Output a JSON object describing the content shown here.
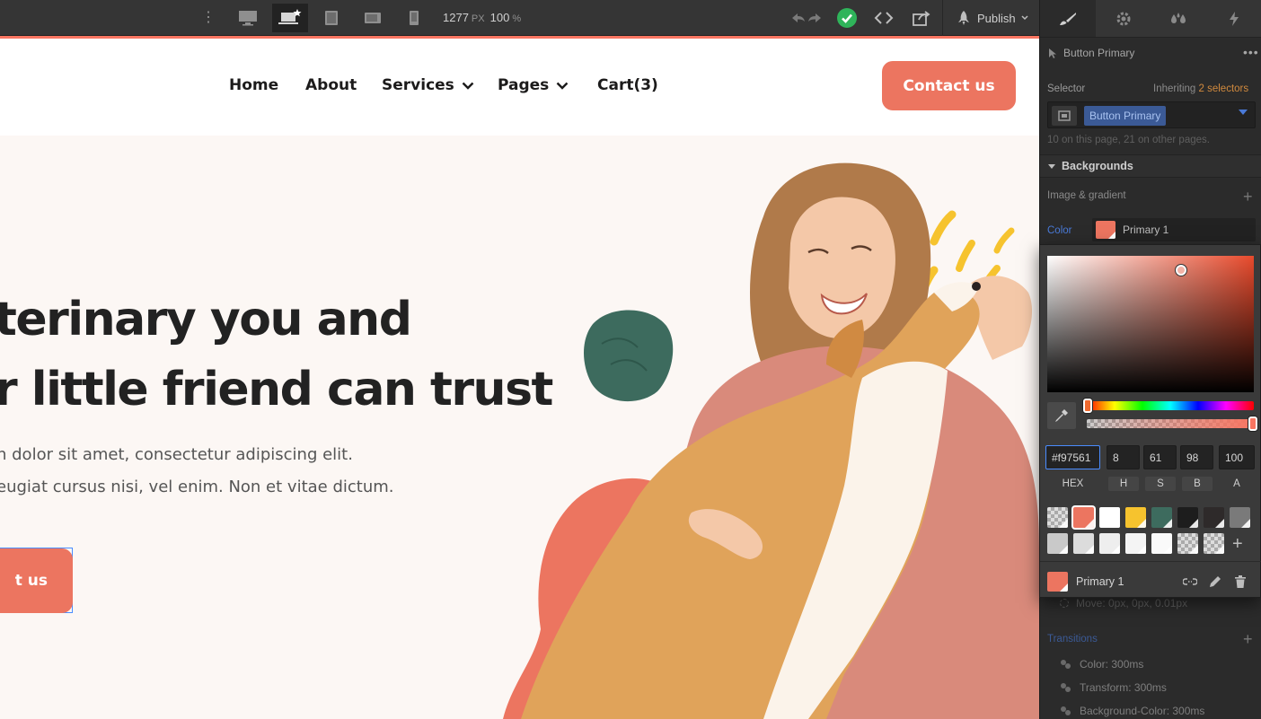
{
  "toolbar": {
    "width_value": "1277",
    "width_unit": "PX",
    "zoom_value": "100",
    "zoom_unit": "%",
    "publish_label": "Publish",
    "breakpoints": [
      "desktop",
      "desktop-base",
      "tablet",
      "mobile-landscape",
      "mobile-portrait"
    ],
    "active_breakpoint": "desktop-base"
  },
  "site": {
    "nav": [
      {
        "label": "Home",
        "dropdown": false
      },
      {
        "label": "About",
        "dropdown": false
      },
      {
        "label": "Services",
        "dropdown": true
      },
      {
        "label": "Pages",
        "dropdown": true
      },
      {
        "label": "Cart(3)",
        "dropdown": false
      }
    ],
    "nav_cta": "Contact us",
    "hero": {
      "title_line1": "terinary you and",
      "title_line2": "r little friend can trust",
      "text_line1": "n dolor sit amet, consectetur adipiscing elit.",
      "text_line2": "eugiat cursus nisi, vel enim. Non et vitae dictum.",
      "button_label": "t us"
    }
  },
  "panel": {
    "tabs": [
      "style-brush-icon",
      "settings-gear-icon",
      "interactions-drops-icon",
      "lightning-icon"
    ],
    "element_name": "Button Primary",
    "selector_label": "Selector",
    "inheriting_prefix": "Inheriting",
    "inheriting_link": "2 selectors",
    "selector_chip": "Button Primary",
    "selector_usage": "10 on this page, 21 on other pages.",
    "section_title": "Backgrounds",
    "image_gradient_label": "Image & gradient",
    "color_label": "Color",
    "color_value_name": "Primary 1",
    "move_text": "Move: 0px, 0px, 0.01px",
    "transitions_label": "Transitions",
    "transitions": [
      "Color: 300ms",
      "Transform: 300ms",
      "Background-Color: 300ms"
    ]
  },
  "picker": {
    "hex": "#f97561",
    "h": "8",
    "s": "61",
    "b": "98",
    "a": "100",
    "labels": [
      "HEX",
      "H",
      "S",
      "B",
      "A"
    ],
    "swatches_row1": [
      "checker",
      "#ec7560",
      "#ffffff",
      "#f6c32e",
      "#3d6b5e",
      "#1d1d1d",
      "#2e2a2a",
      "#7a7a7a"
    ],
    "swatches_row2": [
      "#c9c9c9",
      "#dcdcdc",
      "#eeeeee",
      "#f4f4f4",
      "#fafafa",
      "checker",
      "checker"
    ],
    "selected_swatch_index": 1,
    "variable_name": "Primary 1",
    "colors": {
      "primary": "#f97561",
      "accent_blue": "#4a8cff",
      "dark_green": "#3d6b5e",
      "yellow": "#f6c32e"
    }
  }
}
